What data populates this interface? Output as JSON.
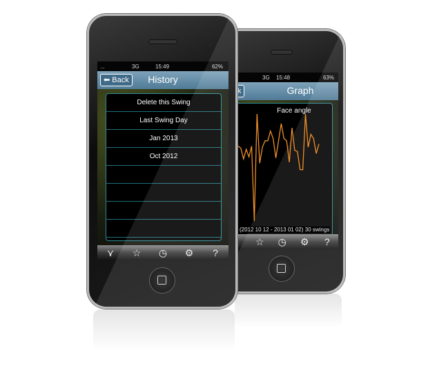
{
  "history_phone": {
    "status": {
      "carrier": "...",
      "network": "3G",
      "time": "15:49",
      "battery": "62%"
    },
    "nav": {
      "back_label": "Back",
      "title": "History"
    },
    "list_items": [
      "Delete this Swing",
      "Last Swing Day",
      "Jan 2013",
      "Oct 2012",
      "",
      "",
      "",
      "",
      ""
    ],
    "tabs": [
      "swing-icon",
      "star-icon",
      "clock-icon",
      "gear-icon",
      "help-icon"
    ]
  },
  "graph_phone": {
    "status": {
      "network": "3G",
      "time": "15:48",
      "battery": "63%"
    },
    "nav": {
      "back_label": "Back",
      "title": "Graph"
    },
    "chart_title": "Face angle",
    "footer": "(2012 10 12 - 2013 01 02) 30 swings",
    "tabs": [
      "star-icon",
      "clock-icon",
      "gear-icon",
      "help-icon"
    ]
  },
  "chart_data": {
    "type": "line",
    "title": "Face angle",
    "line_color": "#f0902a",
    "values": [
      70,
      68,
      58,
      67,
      60,
      70,
      0,
      100,
      54,
      69,
      75,
      75,
      84,
      77,
      59,
      75,
      91,
      77,
      75,
      55,
      87,
      66,
      65,
      48,
      48,
      100,
      69,
      81,
      77,
      63,
      72
    ]
  }
}
